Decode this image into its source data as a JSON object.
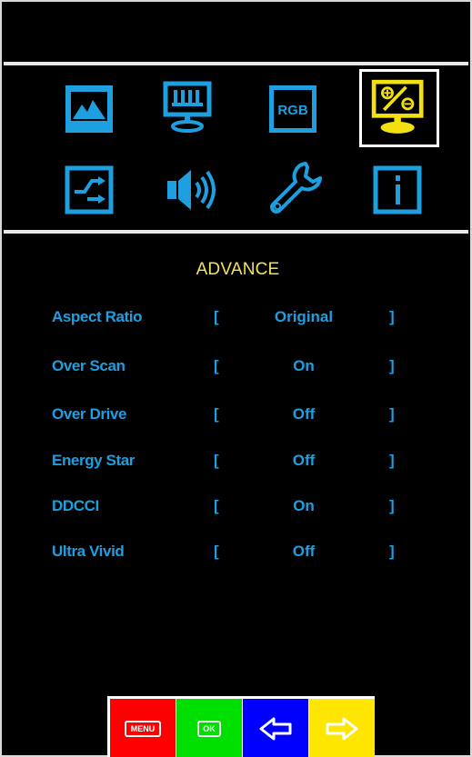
{
  "colors": {
    "background": "#000000",
    "accent_blue": "#1e9fe0",
    "title_yellow": "#f2e35b",
    "selected_icon_yellow": "#f2e010",
    "menu_red": "#ff0000",
    "ok_green": "#00e000",
    "left_blue": "#0000ff",
    "right_yellow": "#ffe600"
  },
  "icons": [
    {
      "name": "picture-icon",
      "selected": false
    },
    {
      "name": "display-icon",
      "selected": false
    },
    {
      "name": "rgb-icon",
      "label": "RGB",
      "selected": false
    },
    {
      "name": "advance-icon",
      "selected": true
    },
    {
      "name": "input-switch-icon",
      "selected": false
    },
    {
      "name": "speaker-icon",
      "selected": false
    },
    {
      "name": "wrench-icon",
      "selected": false
    },
    {
      "name": "info-icon",
      "selected": false
    }
  ],
  "menu": {
    "title": "ADVANCE",
    "bracket_open": "[",
    "bracket_close": "]",
    "rows": [
      {
        "label": "Aspect Ratio",
        "value": "Original"
      },
      {
        "label": "Over Scan",
        "value": "On"
      },
      {
        "label": "Over Drive",
        "value": "Off"
      },
      {
        "label": "Energy Star",
        "value": "Off"
      },
      {
        "label": "DDCCI",
        "value": "On"
      },
      {
        "label": "Ultra Vivid",
        "value": "Off"
      }
    ]
  },
  "buttons": {
    "menu": "MENU",
    "ok": "OK"
  }
}
